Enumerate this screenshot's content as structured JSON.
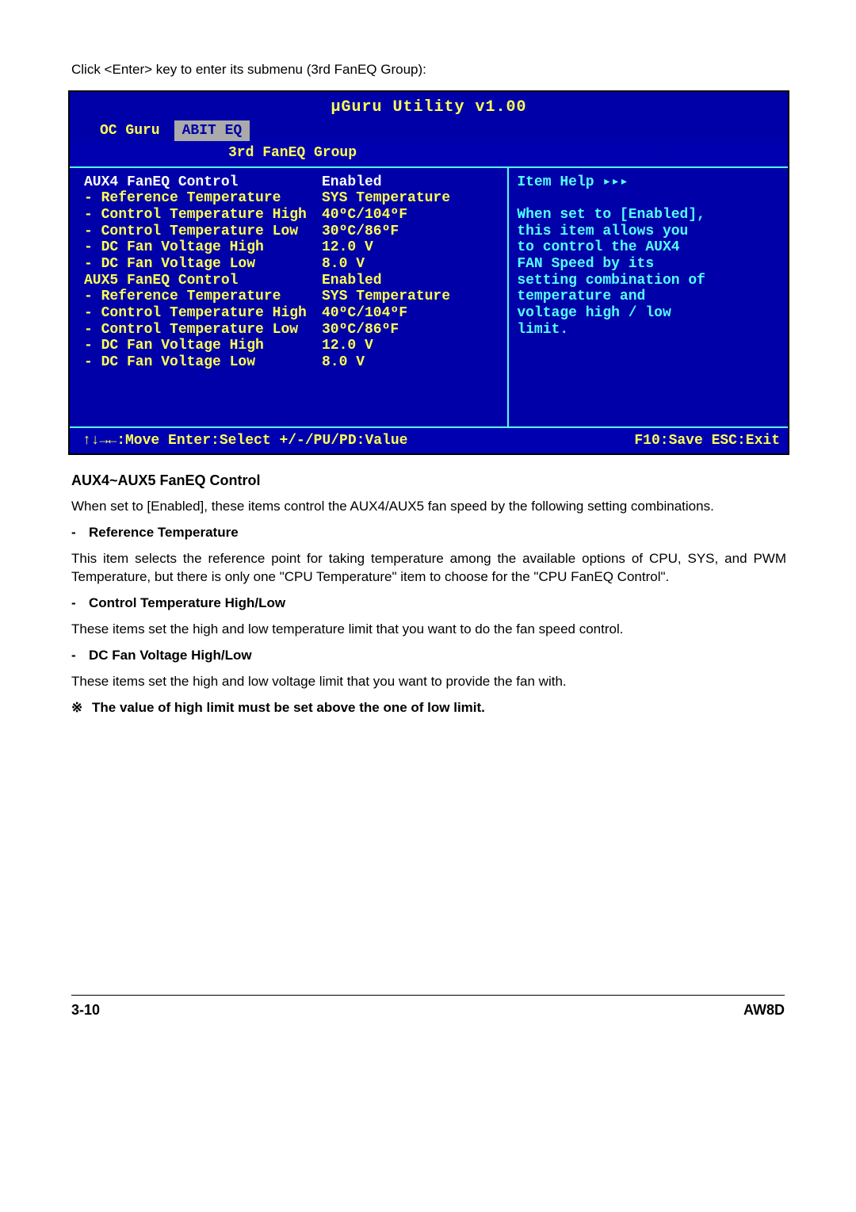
{
  "intro_text": "Click <Enter> key to enter its submenu (3rd FanEQ Group):",
  "bios": {
    "title": "μGuru Utility v1.00",
    "tab_oc": "OC Guru",
    "tab_abit": "ABIT EQ",
    "sub_header": "3rd FanEQ Group",
    "rows": [
      {
        "label": "AUX4 FanEQ Control",
        "value": "Enabled",
        "hl": true
      },
      {
        "label": "- Reference Temperature",
        "value": "SYS Temperature",
        "hl": false
      },
      {
        "label": "- Control Temperature High",
        "value": "40ºC/104ºF",
        "hl": false
      },
      {
        "label": "- Control Temperature Low",
        "value": "30ºC/86ºF",
        "hl": false
      },
      {
        "label": "- DC Fan Voltage High",
        "value": "12.0 V",
        "hl": false
      },
      {
        "label": "- DC Fan Voltage Low",
        "value": "8.0 V",
        "hl": false
      },
      {
        "label": "AUX5 FanEQ Control",
        "value": "Enabled",
        "hl": false
      },
      {
        "label": "- Reference Temperature",
        "value": "SYS Temperature",
        "hl": false
      },
      {
        "label": "- Control Temperature High",
        "value": "40ºC/104ºF",
        "hl": false
      },
      {
        "label": "- Control Temperature Low",
        "value": "30ºC/86ºF",
        "hl": false
      },
      {
        "label": "- DC Fan Voltage High",
        "value": "12.0 V",
        "hl": false
      },
      {
        "label": "- DC Fan Voltage Low",
        "value": "8.0 V",
        "hl": false
      }
    ],
    "help_title": "Item Help ▸▸▸",
    "help_lines": [
      "",
      "When set to [Enabled],",
      "this item allows you",
      "to control the AUX4",
      "FAN Speed by its",
      "setting combination of",
      "temperature and",
      "voltage high / low",
      "limit."
    ],
    "footer_left": "↑↓→←:Move  Enter:Select  +/-/PU/PD:Value",
    "footer_right": "F10:Save  ESC:Exit"
  },
  "sections": {
    "h1": "AUX4~AUX5 FanEQ Control",
    "p1": "When set to [Enabled], these items control the AUX4/AUX5 fan speed by the following setting combinations.",
    "sh2": "Reference Temperature",
    "p2": "This item selects the reference point for taking temperature among the available options of CPU, SYS, and PWM Temperature, but there is only one \"CPU Temperature\" item to choose for the \"CPU FanEQ Control\".",
    "sh3": "Control Temperature High/Low",
    "p3": "These items set the high and low temperature limit that you want to do the fan speed control.",
    "sh4": "DC Fan Voltage High/Low",
    "p4": "These items set the high and low voltage limit that you want to provide the fan with.",
    "note": "The value of high limit must be set above the one of low limit."
  },
  "footer": {
    "left": "3-10",
    "right": "AW8D"
  }
}
